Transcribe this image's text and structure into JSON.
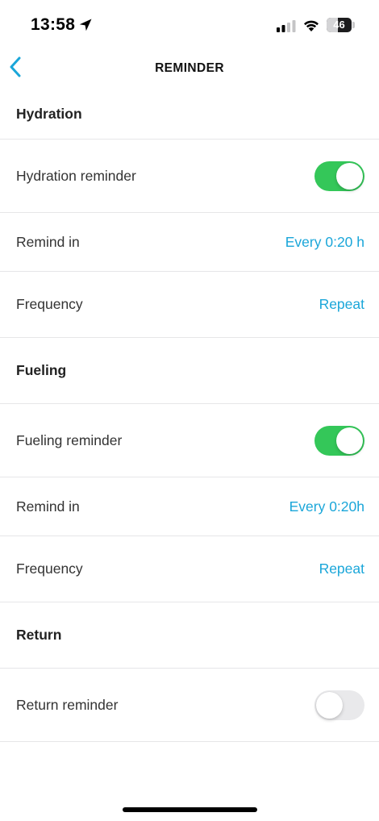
{
  "status_bar": {
    "time": "13:58",
    "battery_level": "46",
    "icons": [
      "location-arrow-icon",
      "signal-icon",
      "wifi-icon",
      "battery-icon"
    ]
  },
  "nav": {
    "title": "REMINDER",
    "back_icon": "chevron-left-icon"
  },
  "sections": {
    "hydration": {
      "header": "Hydration",
      "toggle_label": "Hydration reminder",
      "toggle_on": true,
      "remind_label": "Remind in",
      "remind_value": "Every 0:20 h",
      "frequency_label": "Frequency",
      "frequency_value": "Repeat"
    },
    "fueling": {
      "header": "Fueling",
      "toggle_label": "Fueling reminder",
      "toggle_on": true,
      "remind_label": "Remind in",
      "remind_value": "Every 0:20h",
      "frequency_label": "Frequency",
      "frequency_value": "Repeat"
    },
    "return": {
      "header": "Return",
      "toggle_label": "Return reminder",
      "toggle_on": false
    }
  },
  "colors": {
    "accent": "#1aa6d9",
    "toggle_on": "#34c759",
    "toggle_off": "#e9e9eb",
    "divider": "#e6e6e8"
  }
}
